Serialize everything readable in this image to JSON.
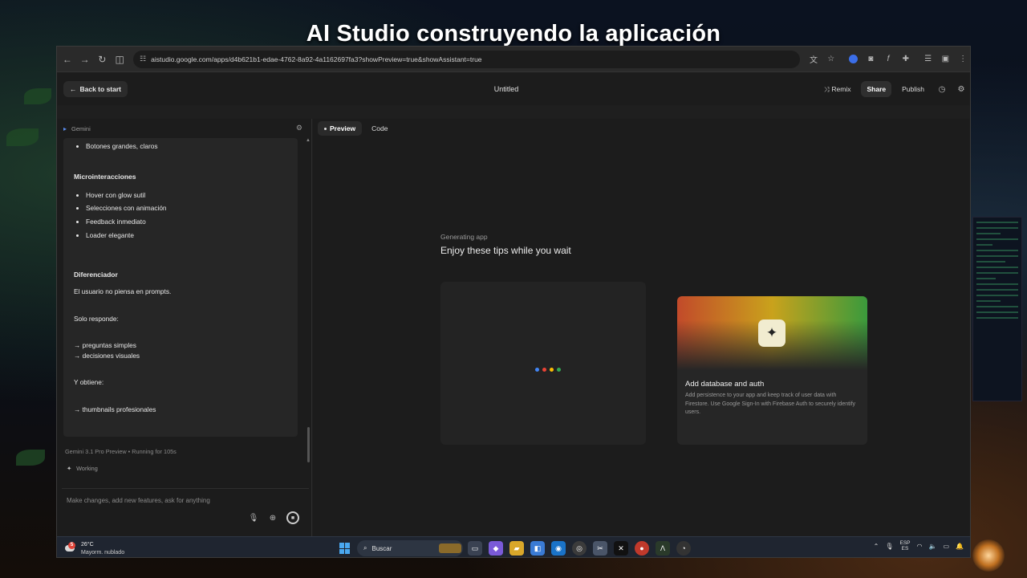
{
  "overlay": {
    "title": "AI Studio construyendo la aplicación"
  },
  "browser": {
    "url": "aistudio.google.com/apps/d4b621b1-edae-4762-8a92-4a1162697fa3?showPreview=true&showAssistant=true",
    "nav_icons": [
      "back-arrow-icon",
      "forward-arrow-icon",
      "reload-icon",
      "split-view-icon"
    ],
    "extension_icons": [
      "translate-icon",
      "star-icon",
      "extension-blue-icon",
      "camera-icon",
      "function-icon",
      "puzzle-icon",
      "playlist-icon",
      "avatar-icon",
      "more-icon"
    ]
  },
  "header": {
    "back_label": "Back to start",
    "doc_title": "Untitled",
    "remix_label": "Remix",
    "share_label": "Share",
    "publish_label": "Publish"
  },
  "assistant": {
    "header_label": "Gemini",
    "chat": {
      "top_bullets": [
        "Botones grandes, claros"
      ],
      "section1_title": "Microinteracciones",
      "section1_bullets": [
        "Hover con glow sutil",
        "Selecciones con animación",
        "Feedback inmediato",
        "Loader elegante"
      ],
      "section2_title": "Diferenciador",
      "p1": "El usuario no piensa en prompts.",
      "p2": "Solo responde:",
      "p3a": "→ preguntas simples",
      "p3b": "→ decisiones visuales",
      "p4": "Y obtiene:",
      "p5": "→ thumbnails profesionales"
    },
    "model_status": "Gemini 3.1 Pro Preview  •  Running for 105s",
    "working_label": "Working",
    "input_placeholder": "Make changes, add new features, ask for anything"
  },
  "preview": {
    "tabs": [
      "Preview",
      "Code"
    ],
    "active_tab": "Preview",
    "generating_label": "Generating app",
    "tips_title": "Enjoy these tips while you wait",
    "loader_colors": [
      "#4285f4",
      "#ea4335",
      "#fbbc04",
      "#34a853"
    ],
    "tip_card": {
      "title": "Add database and auth",
      "body": "Add persistence to your app and keep track of user data with Firestore. Use Google Sign-In with Firebase Auth to securely identify users."
    }
  },
  "taskbar": {
    "weather_badge": "5",
    "temperature": "26°C",
    "condition": "Mayorm. nublado",
    "search_label": "Buscar",
    "lang_top": "ESP",
    "lang_bottom": "ES"
  }
}
